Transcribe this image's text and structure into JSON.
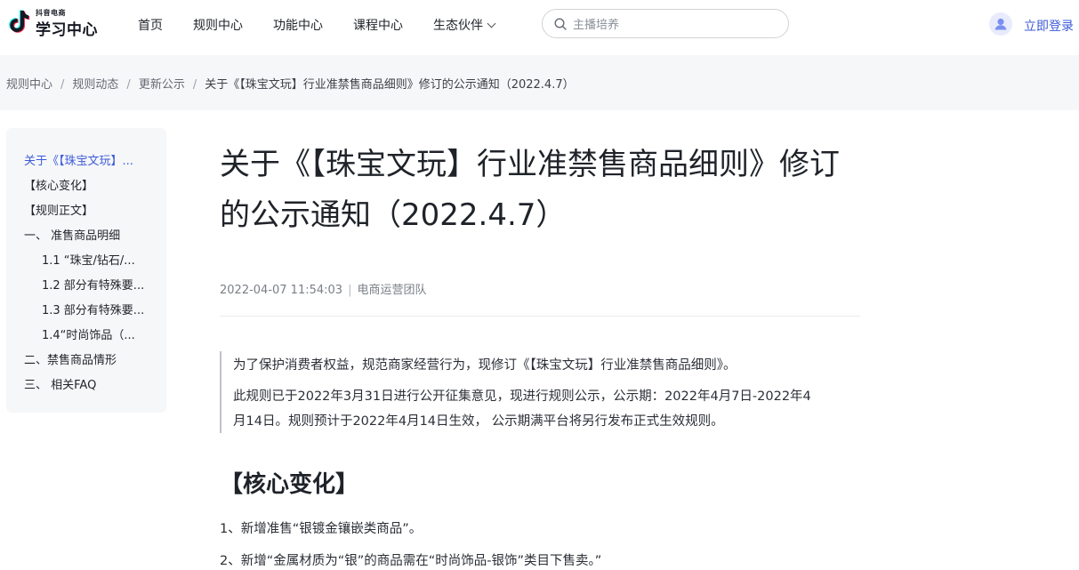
{
  "header": {
    "logo_small": "抖音电商",
    "logo_big": "学习中心",
    "nav": [
      {
        "label": "首页"
      },
      {
        "label": "规则中心"
      },
      {
        "label": "功能中心"
      },
      {
        "label": "课程中心"
      },
      {
        "label": "生态伙伴"
      }
    ],
    "search_placeholder": "主播培养",
    "login_label": "立即登录"
  },
  "breadcrumb": {
    "items": [
      "规则中心",
      "规则动态",
      "更新公示",
      "关于《【珠宝文玩】行业准禁售商品细则》修订的公示通知（2022.4.7）"
    ]
  },
  "toc": {
    "items": [
      {
        "label": "关于《【珠宝文玩】...",
        "active": true
      },
      {
        "label": "【核心变化】"
      },
      {
        "label": "【规则正文】"
      },
      {
        "label": "一、 准售商品明细"
      },
      {
        "label": "1.1 “珠宝/钻石/..."
      },
      {
        "label": "1.2 部分有特殊要..."
      },
      {
        "label": "1.3 部分有特殊要..."
      },
      {
        "label": "1.4“时尚饰品（..."
      },
      {
        "label": "二、禁售商品情形"
      },
      {
        "label": "三、 相关FAQ"
      }
    ]
  },
  "article": {
    "title_line1": "关于《【珠宝文玩】行业准禁售商品细则》修订",
    "title_line2": "的公示通知（2022.4.7）",
    "date": "2022-04-07 11:54:03",
    "author": "电商运营团队",
    "quote_p1": "为了保护消费者权益，规范商家经营行为，现修订《【珠宝文玩】行业准禁售商品细则》。",
    "quote_p2_line1": "此规则已于2022年3月31日进行公开征集意见，现进行规则公示，公示期：2022年4月7日-2022年4",
    "quote_p2_line2": "月14日。规则预计于2022年4月14日生效， 公示期满平台将另行发布正式生效规则。",
    "section_heading": "【核心变化】",
    "list": [
      "1、新增准售“银镀金镶嵌类商品”。",
      "2、新增“金属材质为“银”的商品需在“时尚饰品-银饰”类目下售卖。”"
    ]
  },
  "colors": {
    "accent": "#3d5bd9",
    "text": "#1f2329",
    "panel_bg": "#f6f7f9"
  }
}
